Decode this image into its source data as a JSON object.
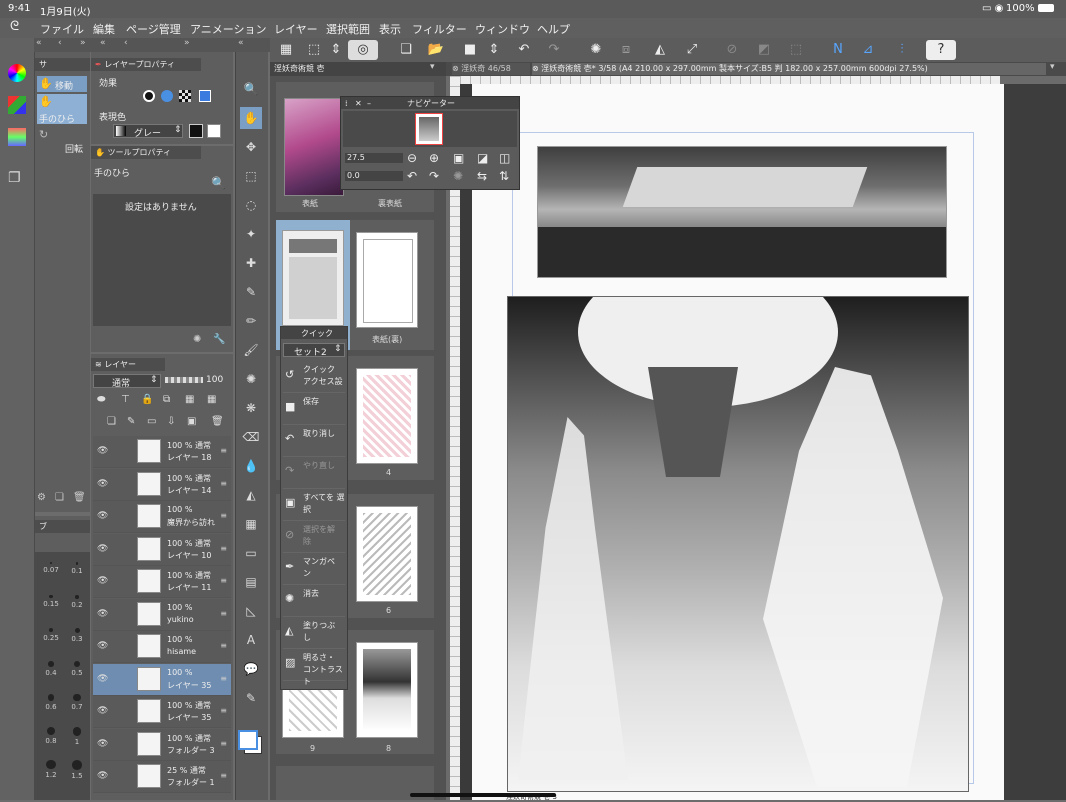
{
  "status": {
    "time": "9:41",
    "date": "1月9日(火)",
    "battery": "100%"
  },
  "menu": [
    "ファイル",
    "編集",
    "ページ管理",
    "アニメーション",
    "レイヤー",
    "選択範囲",
    "表示",
    "フィルター",
    "ウィンドウ",
    "ヘルプ"
  ],
  "tool_sub": {
    "title": "サ",
    "items": [
      "移動",
      "手のひら",
      "回転"
    ]
  },
  "layer_property": {
    "title": "レイヤープロパティ",
    "effect_label": "効果",
    "expression_label": "表現色",
    "expression_value": "グレー"
  },
  "tool_property": {
    "title": "ツールプロパティ",
    "tool_name": "手のひら",
    "empty_text": "設定はありません"
  },
  "layer_panel": {
    "title": "レイヤー",
    "blend": "通常",
    "opacity": "100"
  },
  "layers": [
    {
      "l1": "100 % 通常",
      "l2": "レイヤー 18"
    },
    {
      "l1": "100 % 通常",
      "l2": "レイヤー 14"
    },
    {
      "l1": "100 %",
      "l2": "魔界から訪れ"
    },
    {
      "l1": "100 % 通常",
      "l2": "レイヤー 10"
    },
    {
      "l1": "100 % 通常",
      "l2": "レイヤー 11"
    },
    {
      "l1": "100 %",
      "l2": "yukino"
    },
    {
      "l1": "100 %",
      "l2": "hisame"
    },
    {
      "l1": "100 %",
      "l2": "レイヤー 35"
    },
    {
      "l1": "100 % 通常",
      "l2": "レイヤー 35"
    },
    {
      "l1": "100 % 通常",
      "l2": "フォルダー 3"
    },
    {
      "l1": "25 % 通常",
      "l2": "フォルダー 1"
    }
  ],
  "brush_sizes": [
    "0.07",
    "0.1",
    "0.15",
    "0.2",
    "0.25",
    "0.3",
    "0.4",
    "0.5",
    "0.6",
    "0.7",
    "0.8",
    "1",
    "1.2",
    "1.5"
  ],
  "brush_panel_title": "ブ",
  "page_manager": {
    "title": "淫妖奇術競 壱",
    "cover": "表紙",
    "back_cover": "裏表紙",
    "inside_back": "表紙(裏)",
    "pages": [
      "4",
      "6",
      "9",
      "8"
    ]
  },
  "navigator": {
    "title": "ナビゲーター",
    "zoom": "27.5",
    "angle": "0.0"
  },
  "quick_access": {
    "title": "クイック",
    "set": "セット2",
    "items": [
      "クイック アクセス設",
      "保存",
      "取り消し",
      "やり直し",
      "すべてを 選択",
      "選択を解 除",
      "マンガペ ン",
      "消去",
      "塗りつぶ し",
      "明るさ・ コントラスト"
    ]
  },
  "canvas_tabs": {
    "tab1": "淫妖奇 46/58",
    "tab2": "淫妖奇術競 壱* 3/58 (A4 210.00 x 297.00mm 製本サイズ:B5 判 182.00 x 257.00mm 600dpi 27.5%)"
  },
  "bottom_text": "淫妖奇術競 壱 3"
}
